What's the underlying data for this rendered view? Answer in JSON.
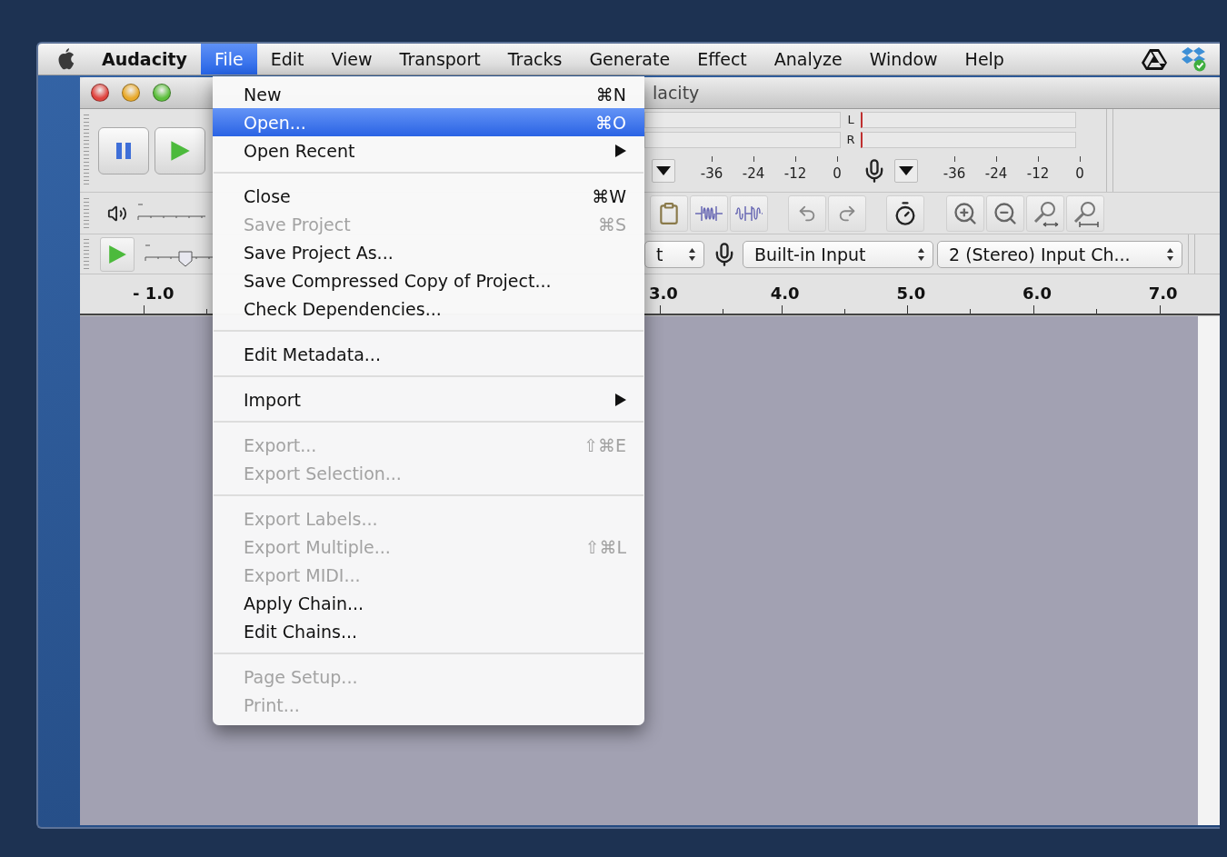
{
  "menu_bar": {
    "app_name": "Audacity",
    "items": [
      {
        "label": "File",
        "selected": true
      },
      {
        "label": "Edit",
        "selected": false
      },
      {
        "label": "View",
        "selected": false
      },
      {
        "label": "Transport",
        "selected": false
      },
      {
        "label": "Tracks",
        "selected": false
      },
      {
        "label": "Generate",
        "selected": false
      },
      {
        "label": "Effect",
        "selected": false
      },
      {
        "label": "Analyze",
        "selected": false
      },
      {
        "label": "Window",
        "selected": false
      },
      {
        "label": "Help",
        "selected": false
      }
    ]
  },
  "window": {
    "title": "lacity"
  },
  "speed_slider": {
    "level": 0.6
  },
  "meters": {
    "channels": [
      "L",
      "R"
    ],
    "playback_scale": [
      "-36",
      "-24",
      "-12",
      "0"
    ],
    "record_scale": [
      "-36",
      "-24",
      "-12",
      "0"
    ]
  },
  "devices": [
    {
      "value": "t"
    },
    {
      "value": "Built-in Input"
    },
    {
      "value": "2 (Stereo) Input Ch..."
    }
  ],
  "ruler": {
    "left_label": "- 1.0",
    "labels": [
      "3.0",
      "4.0",
      "5.0",
      "6.0",
      "7.0"
    ]
  },
  "file_menu": {
    "items": [
      {
        "kind": "item",
        "label": "New",
        "shortcut": "⌘N",
        "disabled": false,
        "selected": false,
        "submenu": false
      },
      {
        "kind": "item",
        "label": "Open...",
        "shortcut": "⌘O",
        "disabled": false,
        "selected": true,
        "submenu": false
      },
      {
        "kind": "item",
        "label": "Open Recent",
        "disabled": false,
        "selected": false,
        "submenu": true
      },
      {
        "kind": "separator"
      },
      {
        "kind": "item",
        "label": "Close",
        "shortcut": "⌘W",
        "disabled": false,
        "selected": false,
        "submenu": false
      },
      {
        "kind": "item",
        "label": "Save Project",
        "shortcut": "⌘S",
        "disabled": true,
        "selected": false,
        "submenu": false
      },
      {
        "kind": "item",
        "label": "Save Project As...",
        "disabled": false,
        "selected": false,
        "submenu": false
      },
      {
        "kind": "item",
        "label": "Save Compressed Copy of Project...",
        "disabled": false,
        "selected": false,
        "submenu": false
      },
      {
        "kind": "item",
        "label": "Check Dependencies...",
        "disabled": false,
        "selected": false,
        "submenu": false
      },
      {
        "kind": "separator"
      },
      {
        "kind": "item",
        "label": "Edit Metadata...",
        "disabled": false,
        "selected": false,
        "submenu": false
      },
      {
        "kind": "separator"
      },
      {
        "kind": "item",
        "label": "Import",
        "disabled": false,
        "selected": false,
        "submenu": true
      },
      {
        "kind": "separator"
      },
      {
        "kind": "item",
        "label": "Export...",
        "shortcut": "⇧⌘E",
        "disabled": true,
        "selected": false,
        "submenu": false
      },
      {
        "kind": "item",
        "label": "Export Selection...",
        "disabled": true,
        "selected": false,
        "submenu": false
      },
      {
        "kind": "separator"
      },
      {
        "kind": "item",
        "label": "Export Labels...",
        "disabled": true,
        "selected": false,
        "submenu": false
      },
      {
        "kind": "item",
        "label": "Export Multiple...",
        "shortcut": "⇧⌘L",
        "disabled": true,
        "selected": false,
        "submenu": false
      },
      {
        "kind": "item",
        "label": "Export MIDI...",
        "disabled": true,
        "selected": false,
        "submenu": false
      },
      {
        "kind": "item",
        "label": "Apply Chain...",
        "disabled": false,
        "selected": false,
        "submenu": false
      },
      {
        "kind": "item",
        "label": "Edit Chains...",
        "disabled": false,
        "selected": false,
        "submenu": false
      },
      {
        "kind": "separator"
      },
      {
        "kind": "item",
        "label": "Page Setup...",
        "disabled": true,
        "selected": false,
        "submenu": false
      },
      {
        "kind": "item",
        "label": "Print...",
        "disabled": true,
        "selected": false,
        "submenu": false
      }
    ]
  }
}
